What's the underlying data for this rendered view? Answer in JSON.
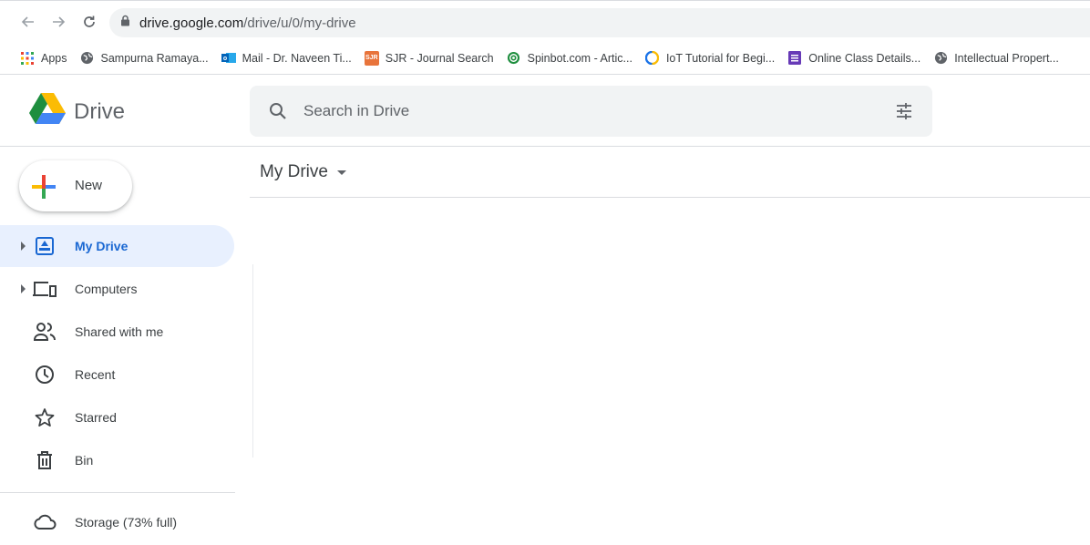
{
  "browser": {
    "url_host": "drive.google.com",
    "url_path": "/drive/u/0/my-drive",
    "bookmarks": [
      {
        "label": "Apps",
        "icon": "apps-grid-icon"
      },
      {
        "label": "Sampurna Ramaya...",
        "icon": "globe-icon"
      },
      {
        "label": "Mail - Dr. Naveen Ti...",
        "icon": "outlook-icon"
      },
      {
        "label": "SJR - Journal Search",
        "icon": "sjr-icon"
      },
      {
        "label": "Spinbot.com - Artic...",
        "icon": "spinbot-icon"
      },
      {
        "label": "IoT Tutorial for Begi...",
        "icon": "iot-icon"
      },
      {
        "label": "Online Class Details...",
        "icon": "forms-icon"
      },
      {
        "label": "Intellectual Propert...",
        "icon": "globe-icon"
      }
    ],
    "sjr_badge": "SJR"
  },
  "header": {
    "app_name": "Drive",
    "search_placeholder": "Search in Drive"
  },
  "sidebar": {
    "new_label": "New",
    "items": [
      {
        "label": "My Drive",
        "icon": "my-drive-icon",
        "active": true,
        "expandable": true
      },
      {
        "label": "Computers",
        "icon": "computers-icon",
        "active": false,
        "expandable": true
      },
      {
        "label": "Shared with me",
        "icon": "shared-people-icon",
        "active": false,
        "expandable": false
      },
      {
        "label": "Recent",
        "icon": "clock-icon",
        "active": false,
        "expandable": false
      },
      {
        "label": "Starred",
        "icon": "star-icon",
        "active": false,
        "expandable": false
      },
      {
        "label": "Bin",
        "icon": "trash-icon",
        "active": false,
        "expandable": false
      }
    ],
    "storage_label": "Storage (73% full)"
  },
  "main": {
    "title": "My Drive"
  },
  "colors": {
    "active_bg": "#e8f0fe",
    "active_text": "#1967d2",
    "search_bg": "#f1f3f4"
  }
}
